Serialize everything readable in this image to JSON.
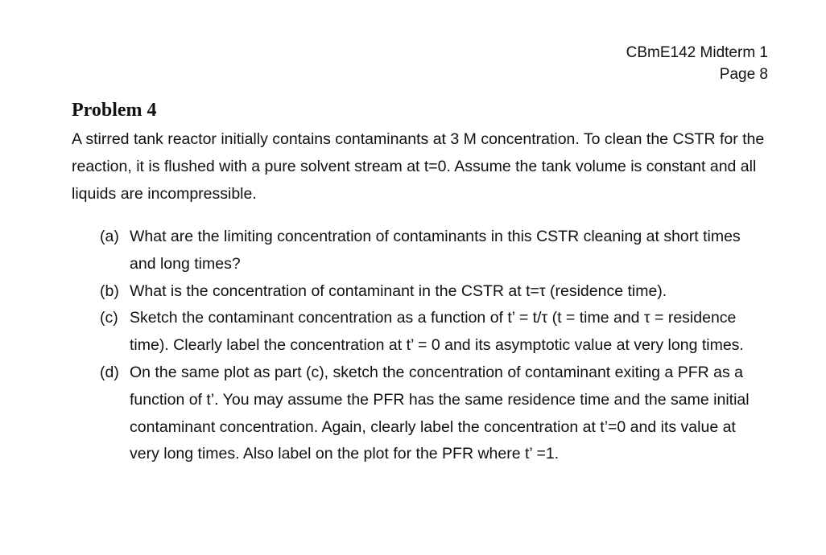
{
  "header": {
    "course_line": "CBmE142 Midterm 1",
    "page_line": "Page 8"
  },
  "problem": {
    "title": "Problem 4",
    "intro": "A stirred tank reactor initially contains contaminants at 3 M concentration.  To clean the CSTR for the reaction, it is flushed with a pure solvent stream at t=0.  Assume the tank volume is constant and all liquids are incompressible.",
    "questions": [
      {
        "label": "(a)",
        "text": "What are the limiting concentration of contaminants in this CSTR cleaning at short times and long times?"
      },
      {
        "label": "(b)",
        "text": "What is the concentration of contaminant in the CSTR at t=τ (residence time)."
      },
      {
        "label": "(c)",
        "text": "Sketch the contaminant concentration as a function of t’ = t/τ  (t = time and τ = residence time). Clearly label the concentration at t’ = 0 and its asymptotic value at very long times."
      },
      {
        "label": "(d)",
        "text": "On the same plot as part (c), sketch the concentration of contaminant exiting a PFR as a function of t’. You may assume the PFR has the same residence time and the same initial contaminant concentration. Again, clearly label the concentration at t’=0 and its value at very long times. Also label on the plot for the PFR where t’ =1."
      }
    ]
  }
}
